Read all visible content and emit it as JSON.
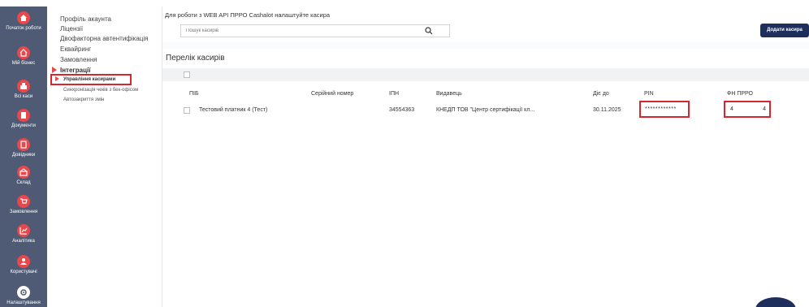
{
  "rail": {
    "items": [
      {
        "label": "Початок роботи",
        "icon": "home-icon"
      },
      {
        "label": "Мій бізнес",
        "icon": "house-icon"
      },
      {
        "label": "Всі каси",
        "icon": "cash-register-icon"
      },
      {
        "label": "Документи",
        "icon": "document-icon"
      },
      {
        "label": "Довідники",
        "icon": "book-icon"
      },
      {
        "label": "Склад",
        "icon": "warehouse-icon"
      },
      {
        "label": "Замовлення",
        "icon": "cart-icon"
      },
      {
        "label": "Аналітика",
        "icon": "chart-icon"
      },
      {
        "label": "Користувачі",
        "icon": "users-icon"
      },
      {
        "label": "Налаштування",
        "icon": "gear-icon"
      }
    ]
  },
  "submenu": {
    "items": [
      "Профіль акаунта",
      "Ліцензії",
      "Двофакторна автентифікація",
      "Еквайринг",
      "Замовлення",
      "Інтеграції"
    ],
    "sub_items": [
      "Управління касирами",
      "Синхронізація чеків з бек-офісом",
      "Автозакриття змін"
    ]
  },
  "main": {
    "hint": "Для роботи з WEB API ПРРО Cashalot налаштуйте касира",
    "search_placeholder": "Пошук касирів",
    "add_button": "Додати касира",
    "panel_title": "Перелік касирів",
    "columns": [
      "ПІБ",
      "Серійний номер",
      "ІПН",
      "Видавець",
      "Діє до",
      "PIN",
      "ФН ПРРО"
    ],
    "rows": [
      {
        "name": "Тестовий платник 4 (Тест)",
        "serial": "",
        "ipn": "34554363",
        "issuer": "КНЕДП ТОВ \"Центр сертифікації кл...",
        "valid_until": "30.11.2025",
        "pin": "************",
        "fn_left": "4",
        "fn_right": "4"
      }
    ]
  },
  "colors": {
    "accent": "#e8474c",
    "rail": "#4f5b74",
    "primary_button": "#1f2f5c",
    "highlight_box": "#d9262e"
  }
}
